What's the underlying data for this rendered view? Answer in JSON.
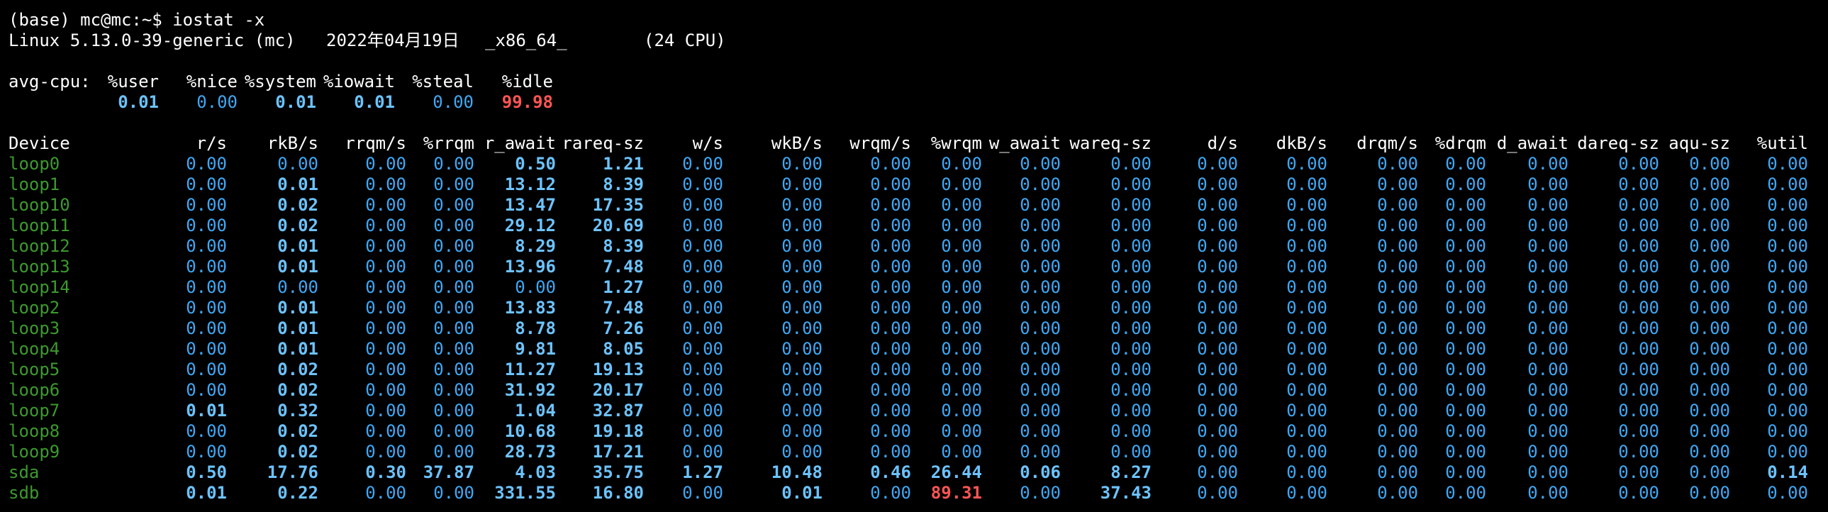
{
  "terminal": {
    "prompt": "(base) mc@mc:~$ iostat -x",
    "sysinfo": {
      "kernel": "Linux 5.13.0-39-generic (mc)",
      "date": "2022年04月19日",
      "arch": "_x86_64_",
      "cpus": "(24 CPU)"
    },
    "cpu": {
      "label": "avg-cpu:",
      "headers": [
        "%user",
        "%nice",
        "%system",
        "%iowait",
        "%steal",
        "%idle"
      ],
      "values": [
        {
          "v": "0.01",
          "s": "bold"
        },
        {
          "v": "0.00",
          "s": "val"
        },
        {
          "v": "0.01",
          "s": "bold"
        },
        {
          "v": "0.01",
          "s": "bold"
        },
        {
          "v": "0.00",
          "s": "val"
        },
        {
          "v": "99.98",
          "s": "red"
        }
      ]
    },
    "device_table": {
      "headers": [
        "Device",
        "r/s",
        "rkB/s",
        "rrqm/s",
        "%rrqm",
        "r_await",
        "rareq-sz",
        "w/s",
        "wkB/s",
        "wrqm/s",
        "%wrqm",
        "w_await",
        "wareq-sz",
        "d/s",
        "dkB/s",
        "drqm/s",
        "%drqm",
        "d_await",
        "dareq-sz",
        "aqu-sz",
        "%util"
      ],
      "rows": [
        {
          "device": "loop0",
          "values": [
            "0.00",
            "0.00",
            "0.00",
            "0.00",
            "0.50",
            "1.21",
            "0.00",
            "0.00",
            "0.00",
            "0.00",
            "0.00",
            "0.00",
            "0.00",
            "0.00",
            "0.00",
            "0.00",
            "0.00",
            "0.00",
            "0.00",
            "0.00"
          ],
          "bold": [
            4,
            5
          ],
          "red": []
        },
        {
          "device": "loop1",
          "values": [
            "0.00",
            "0.01",
            "0.00",
            "0.00",
            "13.12",
            "8.39",
            "0.00",
            "0.00",
            "0.00",
            "0.00",
            "0.00",
            "0.00",
            "0.00",
            "0.00",
            "0.00",
            "0.00",
            "0.00",
            "0.00",
            "0.00",
            "0.00"
          ],
          "bold": [
            1,
            4,
            5
          ],
          "red": []
        },
        {
          "device": "loop10",
          "values": [
            "0.00",
            "0.02",
            "0.00",
            "0.00",
            "13.47",
            "17.35",
            "0.00",
            "0.00",
            "0.00",
            "0.00",
            "0.00",
            "0.00",
            "0.00",
            "0.00",
            "0.00",
            "0.00",
            "0.00",
            "0.00",
            "0.00",
            "0.00"
          ],
          "bold": [
            1,
            4,
            5
          ],
          "red": []
        },
        {
          "device": "loop11",
          "values": [
            "0.00",
            "0.02",
            "0.00",
            "0.00",
            "29.12",
            "20.69",
            "0.00",
            "0.00",
            "0.00",
            "0.00",
            "0.00",
            "0.00",
            "0.00",
            "0.00",
            "0.00",
            "0.00",
            "0.00",
            "0.00",
            "0.00",
            "0.00"
          ],
          "bold": [
            1,
            4,
            5
          ],
          "red": []
        },
        {
          "device": "loop12",
          "values": [
            "0.00",
            "0.01",
            "0.00",
            "0.00",
            "8.29",
            "8.39",
            "0.00",
            "0.00",
            "0.00",
            "0.00",
            "0.00",
            "0.00",
            "0.00",
            "0.00",
            "0.00",
            "0.00",
            "0.00",
            "0.00",
            "0.00",
            "0.00"
          ],
          "bold": [
            1,
            4,
            5
          ],
          "red": []
        },
        {
          "device": "loop13",
          "values": [
            "0.00",
            "0.01",
            "0.00",
            "0.00",
            "13.96",
            "7.48",
            "0.00",
            "0.00",
            "0.00",
            "0.00",
            "0.00",
            "0.00",
            "0.00",
            "0.00",
            "0.00",
            "0.00",
            "0.00",
            "0.00",
            "0.00",
            "0.00"
          ],
          "bold": [
            1,
            4,
            5
          ],
          "red": []
        },
        {
          "device": "loop14",
          "values": [
            "0.00",
            "0.00",
            "0.00",
            "0.00",
            "0.00",
            "1.27",
            "0.00",
            "0.00",
            "0.00",
            "0.00",
            "0.00",
            "0.00",
            "0.00",
            "0.00",
            "0.00",
            "0.00",
            "0.00",
            "0.00",
            "0.00",
            "0.00"
          ],
          "bold": [
            5
          ],
          "red": []
        },
        {
          "device": "loop2",
          "values": [
            "0.00",
            "0.01",
            "0.00",
            "0.00",
            "13.83",
            "7.48",
            "0.00",
            "0.00",
            "0.00",
            "0.00",
            "0.00",
            "0.00",
            "0.00",
            "0.00",
            "0.00",
            "0.00",
            "0.00",
            "0.00",
            "0.00",
            "0.00"
          ],
          "bold": [
            1,
            4,
            5
          ],
          "red": []
        },
        {
          "device": "loop3",
          "values": [
            "0.00",
            "0.01",
            "0.00",
            "0.00",
            "8.78",
            "7.26",
            "0.00",
            "0.00",
            "0.00",
            "0.00",
            "0.00",
            "0.00",
            "0.00",
            "0.00",
            "0.00",
            "0.00",
            "0.00",
            "0.00",
            "0.00",
            "0.00"
          ],
          "bold": [
            1,
            4,
            5
          ],
          "red": []
        },
        {
          "device": "loop4",
          "values": [
            "0.00",
            "0.01",
            "0.00",
            "0.00",
            "9.81",
            "8.05",
            "0.00",
            "0.00",
            "0.00",
            "0.00",
            "0.00",
            "0.00",
            "0.00",
            "0.00",
            "0.00",
            "0.00",
            "0.00",
            "0.00",
            "0.00",
            "0.00"
          ],
          "bold": [
            1,
            4,
            5
          ],
          "red": []
        },
        {
          "device": "loop5",
          "values": [
            "0.00",
            "0.02",
            "0.00",
            "0.00",
            "11.27",
            "19.13",
            "0.00",
            "0.00",
            "0.00",
            "0.00",
            "0.00",
            "0.00",
            "0.00",
            "0.00",
            "0.00",
            "0.00",
            "0.00",
            "0.00",
            "0.00",
            "0.00"
          ],
          "bold": [
            1,
            4,
            5
          ],
          "red": []
        },
        {
          "device": "loop6",
          "values": [
            "0.00",
            "0.02",
            "0.00",
            "0.00",
            "31.92",
            "20.17",
            "0.00",
            "0.00",
            "0.00",
            "0.00",
            "0.00",
            "0.00",
            "0.00",
            "0.00",
            "0.00",
            "0.00",
            "0.00",
            "0.00",
            "0.00",
            "0.00"
          ],
          "bold": [
            1,
            4,
            5
          ],
          "red": []
        },
        {
          "device": "loop7",
          "values": [
            "0.01",
            "0.32",
            "0.00",
            "0.00",
            "1.04",
            "32.87",
            "0.00",
            "0.00",
            "0.00",
            "0.00",
            "0.00",
            "0.00",
            "0.00",
            "0.00",
            "0.00",
            "0.00",
            "0.00",
            "0.00",
            "0.00",
            "0.00"
          ],
          "bold": [
            0,
            1,
            4,
            5
          ],
          "red": []
        },
        {
          "device": "loop8",
          "values": [
            "0.00",
            "0.02",
            "0.00",
            "0.00",
            "10.68",
            "19.18",
            "0.00",
            "0.00",
            "0.00",
            "0.00",
            "0.00",
            "0.00",
            "0.00",
            "0.00",
            "0.00",
            "0.00",
            "0.00",
            "0.00",
            "0.00",
            "0.00"
          ],
          "bold": [
            1,
            4,
            5
          ],
          "red": []
        },
        {
          "device": "loop9",
          "values": [
            "0.00",
            "0.02",
            "0.00",
            "0.00",
            "28.73",
            "17.21",
            "0.00",
            "0.00",
            "0.00",
            "0.00",
            "0.00",
            "0.00",
            "0.00",
            "0.00",
            "0.00",
            "0.00",
            "0.00",
            "0.00",
            "0.00",
            "0.00"
          ],
          "bold": [
            1,
            4,
            5
          ],
          "red": []
        },
        {
          "device": "sda",
          "values": [
            "0.50",
            "17.76",
            "0.30",
            "37.87",
            "4.03",
            "35.75",
            "1.27",
            "10.48",
            "0.46",
            "26.44",
            "0.06",
            "8.27",
            "0.00",
            "0.00",
            "0.00",
            "0.00",
            "0.00",
            "0.00",
            "0.00",
            "0.14"
          ],
          "bold": [
            0,
            1,
            2,
            3,
            4,
            5,
            6,
            7,
            8,
            9,
            10,
            11,
            19
          ],
          "red": []
        },
        {
          "device": "sdb",
          "values": [
            "0.01",
            "0.22",
            "0.00",
            "0.00",
            "331.55",
            "16.80",
            "0.00",
            "0.01",
            "0.00",
            "89.31",
            "0.00",
            "37.43",
            "0.00",
            "0.00",
            "0.00",
            "0.00",
            "0.00",
            "0.00",
            "0.00",
            "0.00"
          ],
          "bold": [
            0,
            1,
            4,
            5,
            7,
            11
          ],
          "red": [
            9
          ]
        }
      ]
    }
  }
}
